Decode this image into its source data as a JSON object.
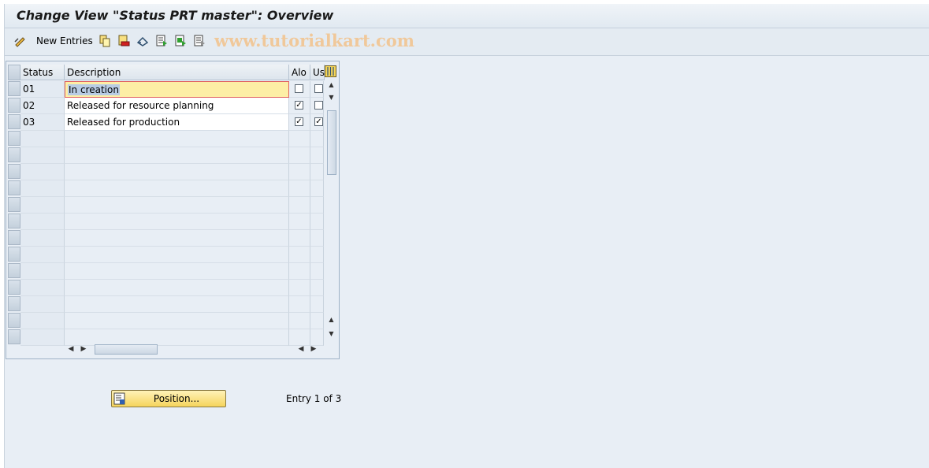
{
  "window": {
    "title": "Change View \"Status PRT master\": Overview"
  },
  "toolbar": {
    "new_entries_label": "New Entries",
    "watermark": "www.tutorialkart.com",
    "icons": [
      "change-display-icon",
      "copy-icon",
      "delete-icon",
      "undo-icon",
      "select-all-icon",
      "select-block-icon",
      "deselect-all-icon"
    ]
  },
  "table": {
    "columns": [
      "Status",
      "Description",
      "Alo",
      "Us"
    ],
    "rows": [
      {
        "status": "01",
        "description": "In creation",
        "alo": false,
        "us": false
      },
      {
        "status": "02",
        "description": "Released for resource planning",
        "alo": true,
        "us": false
      },
      {
        "status": "03",
        "description": "Released for production",
        "alo": true,
        "us": true
      }
    ],
    "selected_row_index": 0
  },
  "footer": {
    "position_label": "Position...",
    "entry_info": "Entry 1 of 3"
  },
  "colors": {
    "background": "#e8eef5",
    "selected_cell": "#fdeea5",
    "button": "#f5d45c"
  }
}
